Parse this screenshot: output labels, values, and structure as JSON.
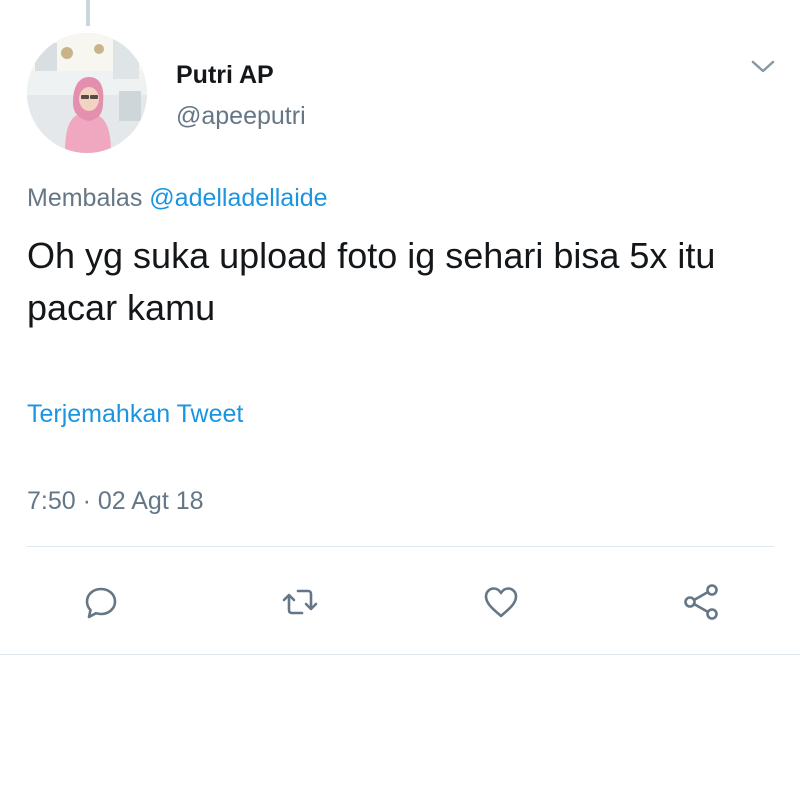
{
  "tweet": {
    "author": {
      "display_name": "Putri AP",
      "handle": "@apeeputri",
      "avatar_icon": "profile-photo"
    },
    "reply_prefix": "Membalas",
    "reply_to_handle": "@adelladellaide",
    "text": "Oh yg suka upload foto ig sehari bisa 5x itu pacar kamu",
    "translate_label": "Terjemahkan Tweet",
    "timestamp": "7:50 · 02 Agt 18",
    "menu_icon": "chevron-down-icon"
  },
  "actions": [
    {
      "icon": "reply-icon"
    },
    {
      "icon": "retweet-icon"
    },
    {
      "icon": "like-icon"
    },
    {
      "icon": "share-icon"
    }
  ],
  "colors": {
    "link": "#1b95e0",
    "secondary_text": "#657786",
    "primary_text": "#14171a",
    "divider": "#e1e8ed",
    "icon": "#657786"
  }
}
